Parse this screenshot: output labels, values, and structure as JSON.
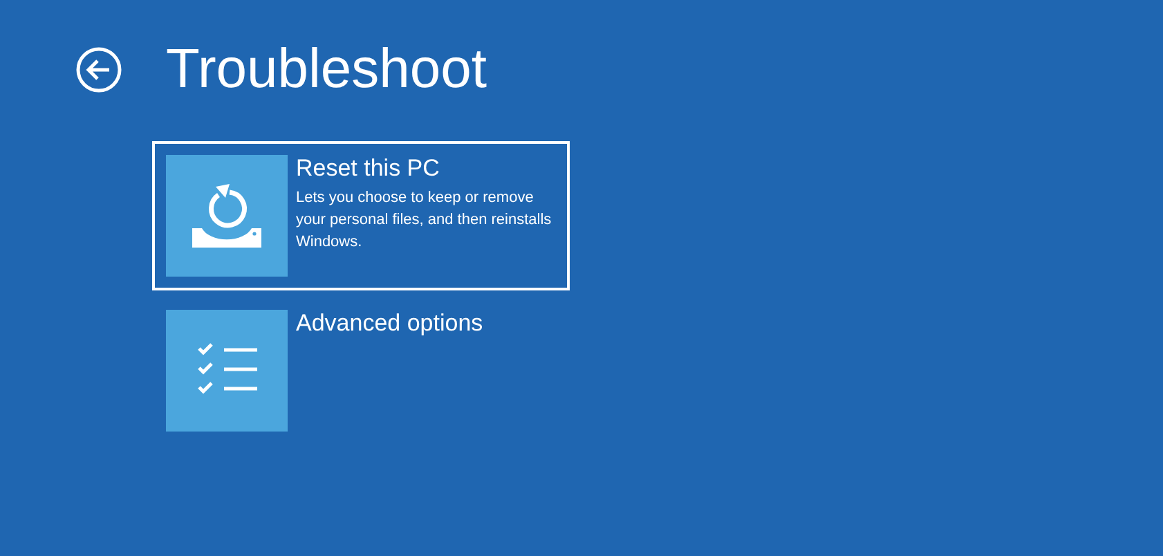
{
  "title": "Troubleshoot",
  "options": [
    {
      "kind": "reset",
      "title": "Reset this PC",
      "description": "Lets you choose to keep or remove your personal files, and then reinstalls Windows.",
      "selected": true
    },
    {
      "kind": "checklist",
      "title": "Advanced options",
      "selected": false
    }
  ]
}
